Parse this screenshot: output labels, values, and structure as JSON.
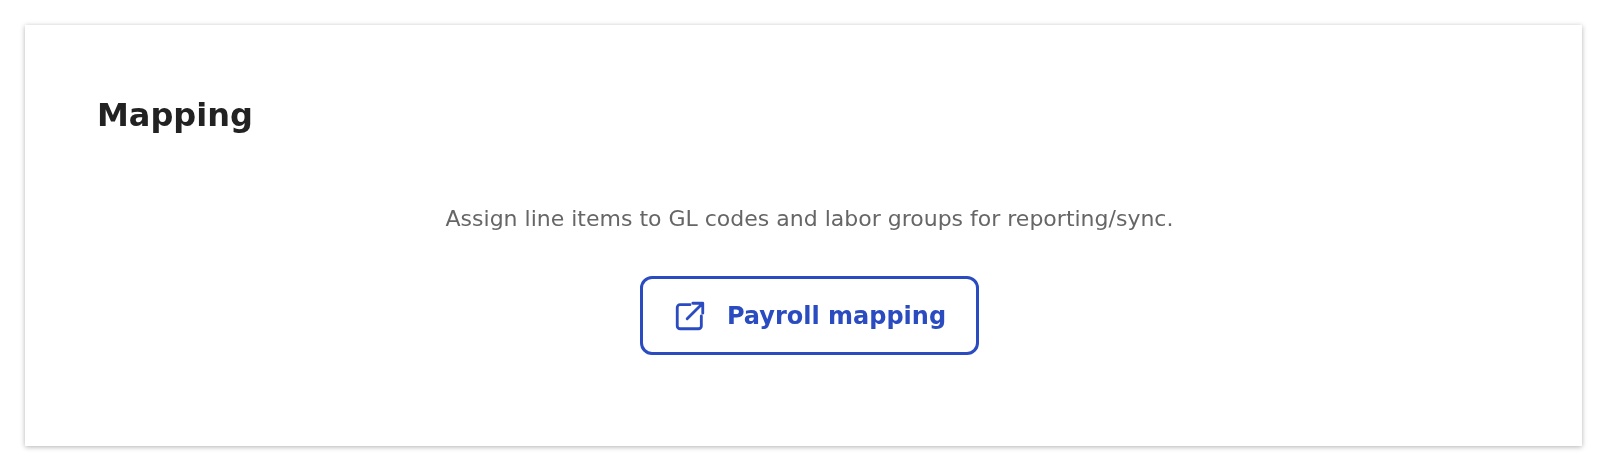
{
  "card": {
    "title": "Mapping",
    "description": "Assign line items to GL codes and labor groups for reporting/sync.",
    "button": {
      "label": "Payroll mapping"
    }
  }
}
